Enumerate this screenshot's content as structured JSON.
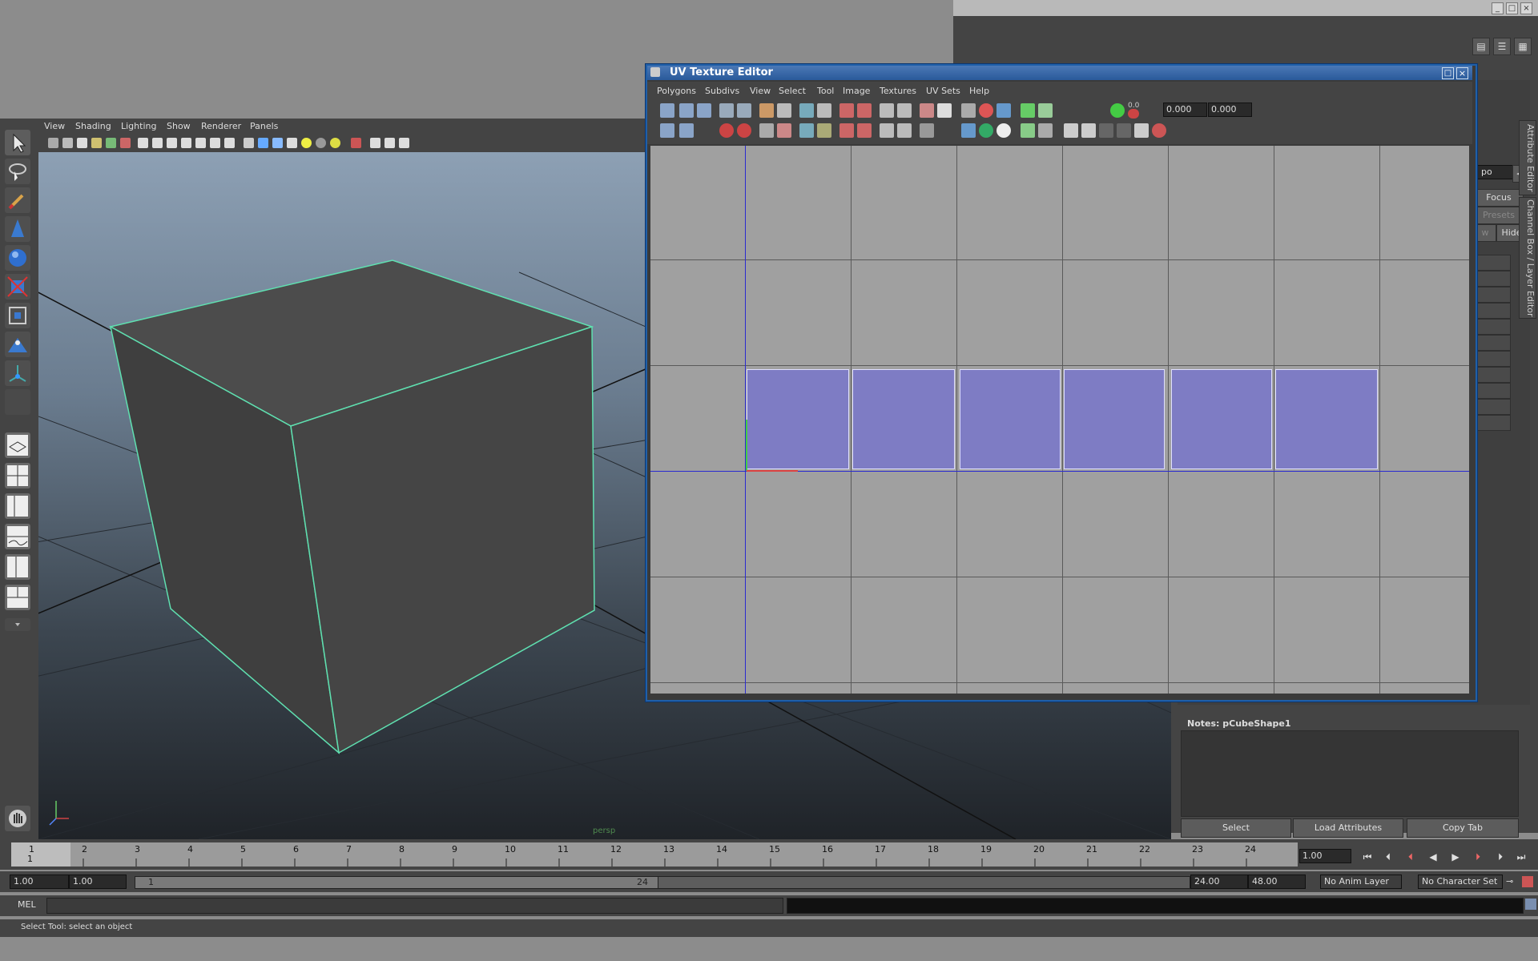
{
  "viewport": {
    "menu": [
      "View",
      "Shading",
      "Lighting",
      "Show",
      "Renderer",
      "Panels"
    ],
    "camera_label": "persp"
  },
  "uv_editor": {
    "title": "UV Texture Editor",
    "menu": [
      "Polygons",
      "Subdivs",
      "View",
      "Select",
      "Tool",
      "Image",
      "Textures",
      "UV Sets",
      "Help"
    ],
    "field_u": "0.000",
    "field_v": "0.000",
    "small_label": "0.0"
  },
  "attribute": {
    "field_text": "po",
    "focus_label": "Focus",
    "presets_label": "Presets",
    "show_label": "w",
    "hide_label": "Hide",
    "notes_label": "Notes:  pCubeShape1",
    "select_label": "Select",
    "load_label": "Load Attributes",
    "copy_label": "Copy Tab",
    "tab_attribute": "Attribute Editor",
    "tab_channel": "Channel Box / Layer Editor"
  },
  "timeline": {
    "ticks": [
      "1",
      "2",
      "3",
      "4",
      "5",
      "6",
      "7",
      "8",
      "9",
      "10",
      "11",
      "12",
      "13",
      "14",
      "15",
      "16",
      "17",
      "18",
      "19",
      "20",
      "21",
      "22",
      "23",
      "24"
    ],
    "current_frame_marker": "1",
    "current_field": "1.00"
  },
  "range": {
    "start_field": "1.00",
    "start_field2": "1.00",
    "slider_left": "1",
    "slider_right": "24",
    "end_field": "24.00",
    "end_field2": "48.00",
    "anim_layer": "No Anim Layer",
    "char_set": "No Character Set"
  },
  "mel": {
    "label": "MEL",
    "status": "Select Tool: select an object"
  }
}
